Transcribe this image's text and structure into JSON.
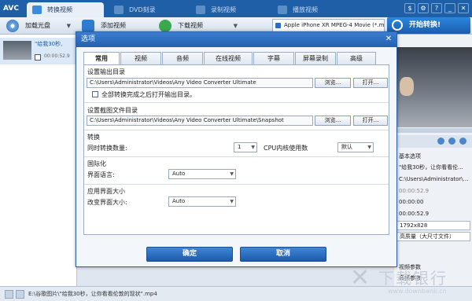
{
  "app": {
    "logo": "AVC"
  },
  "tabs": [
    {
      "label": "转换视频",
      "active": true
    },
    {
      "label": "DVD刻录",
      "active": false
    },
    {
      "label": "录制视频",
      "active": false
    },
    {
      "label": "播放视频",
      "active": false
    }
  ],
  "window_buttons": [
    "$",
    "⚙",
    "?",
    "_",
    "✕"
  ],
  "toolbar": {
    "load_disc": "加载光盘",
    "add_video": "添加视频",
    "download_video": "下载视频",
    "profile": "Apple iPhone XR MPEG-4 Movie (*.m...",
    "convert_now": "开始转换!"
  },
  "file_item": {
    "name": "\"给我30秒,",
    "duration": "00:00:52.9"
  },
  "right_panel": {
    "section": "基本选项",
    "output_name": "\"给我30秒，让你看看伦...",
    "output_dir": "C:\\Users\\Administrator\\...",
    "duration": "00:00:52.9",
    "start_time": "00:00:00",
    "end_time": "00:00:52.9",
    "resolution": "1792x828",
    "quality": "高质量（大尺寸文件）",
    "video_params": "视频参数",
    "audio_params": "音频参数"
  },
  "status": {
    "path": "E:\\谷歌图片\\\"给我30秒，让你看看伦敦的现状\".mp4"
  },
  "watermark": {
    "logo": "✕",
    "text": "下载银行",
    "url": "www.downbank.cn"
  },
  "dialog": {
    "title": "选项",
    "close": "✕",
    "tabs": [
      "常用",
      "视频",
      "音频",
      "在线视频",
      "字幕",
      "屏幕录制",
      "高级"
    ],
    "output_dir_label": "设置输出目录",
    "output_dir_value": "C:\\Users\\Administrator\\Videos\\Any Video Converter Ultimate",
    "browse": "浏览...",
    "open": "打开...",
    "open_after_label": "全部转换完成之后打开输出目录。",
    "open_after_checked": false,
    "snapshot_dir_label": "设置截图文件目录",
    "snapshot_dir_value": "C:\\Users\\Administrator\\Videos\\Any Video Converter Ultimate\\Snapshot",
    "convert_section": "转换",
    "concurrent_label": "同时转换数量:",
    "concurrent_value": "1",
    "cpu_label": "CPU内核使用数",
    "cpu_value": "默认",
    "intl_section": "国际化",
    "lang_label": "界面语言:",
    "lang_value": "Auto",
    "size_section": "应用界面大小",
    "size_label": "改变界面大小:",
    "size_value": "Auto",
    "ok": "确定",
    "cancel": "取消"
  },
  "colors": {
    "titlebar": "#1f5fa8",
    "accent": "#2461ad",
    "dialog_bg": "#f3f6fa"
  }
}
